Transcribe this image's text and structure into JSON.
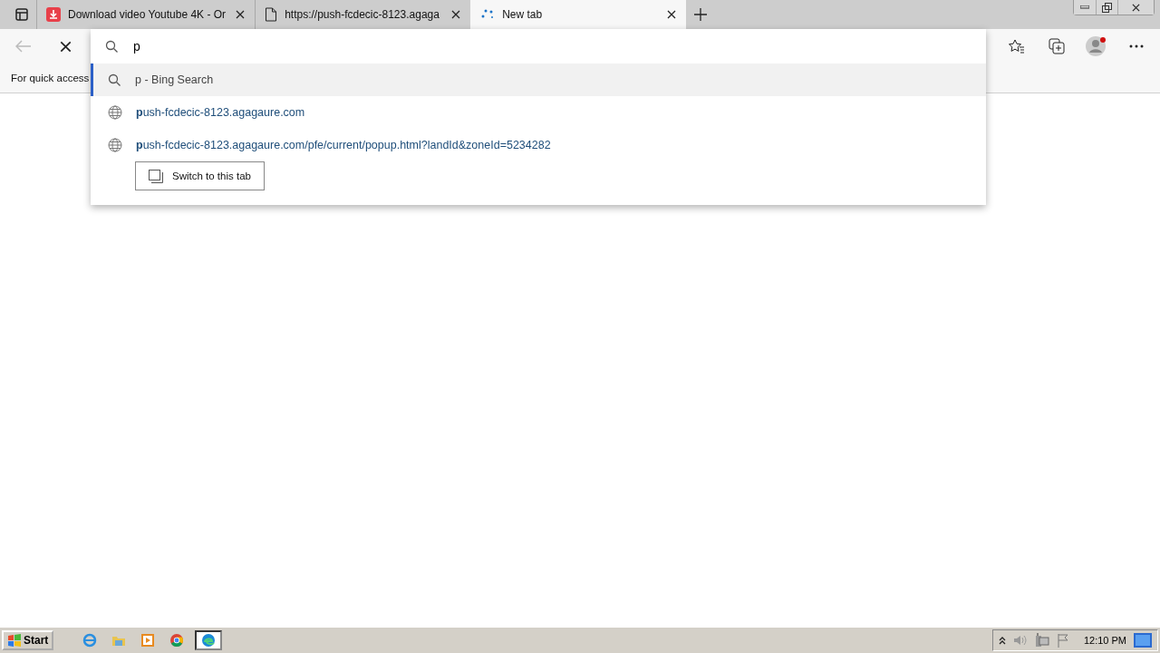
{
  "tabs": [
    {
      "title": "Download video Youtube 4K - Or",
      "kind": "download",
      "selected": false
    },
    {
      "title": "https://push-fcdecic-8123.agaga",
      "kind": "page",
      "selected": false
    },
    {
      "title": "New tab",
      "kind": "loading",
      "selected": true
    }
  ],
  "address_bar": {
    "value": "p"
  },
  "favorites_bar": {
    "text": "For quick access"
  },
  "suggestions": [
    {
      "kind": "search",
      "text": "p - Bing Search",
      "selected": true
    },
    {
      "kind": "site",
      "text": "**p**ush-fcdecic-8123.agagaure.com",
      "selected": false
    },
    {
      "kind": "site",
      "text": "**p**ush-fcdecic-8123.agagaure.com/pfe/current/popup.html?landId&zoneId=5234282",
      "selected": false,
      "action": "Switch to this tab"
    }
  ],
  "taskbar": {
    "start": "Start",
    "apps": [
      {
        "kind": "ie",
        "selected": false
      },
      {
        "kind": "folder",
        "selected": false
      },
      {
        "kind": "media",
        "selected": false
      },
      {
        "kind": "chrome",
        "selected": false
      },
      {
        "kind": "edge",
        "selected": true
      }
    ],
    "clock": "12:10 PM"
  }
}
